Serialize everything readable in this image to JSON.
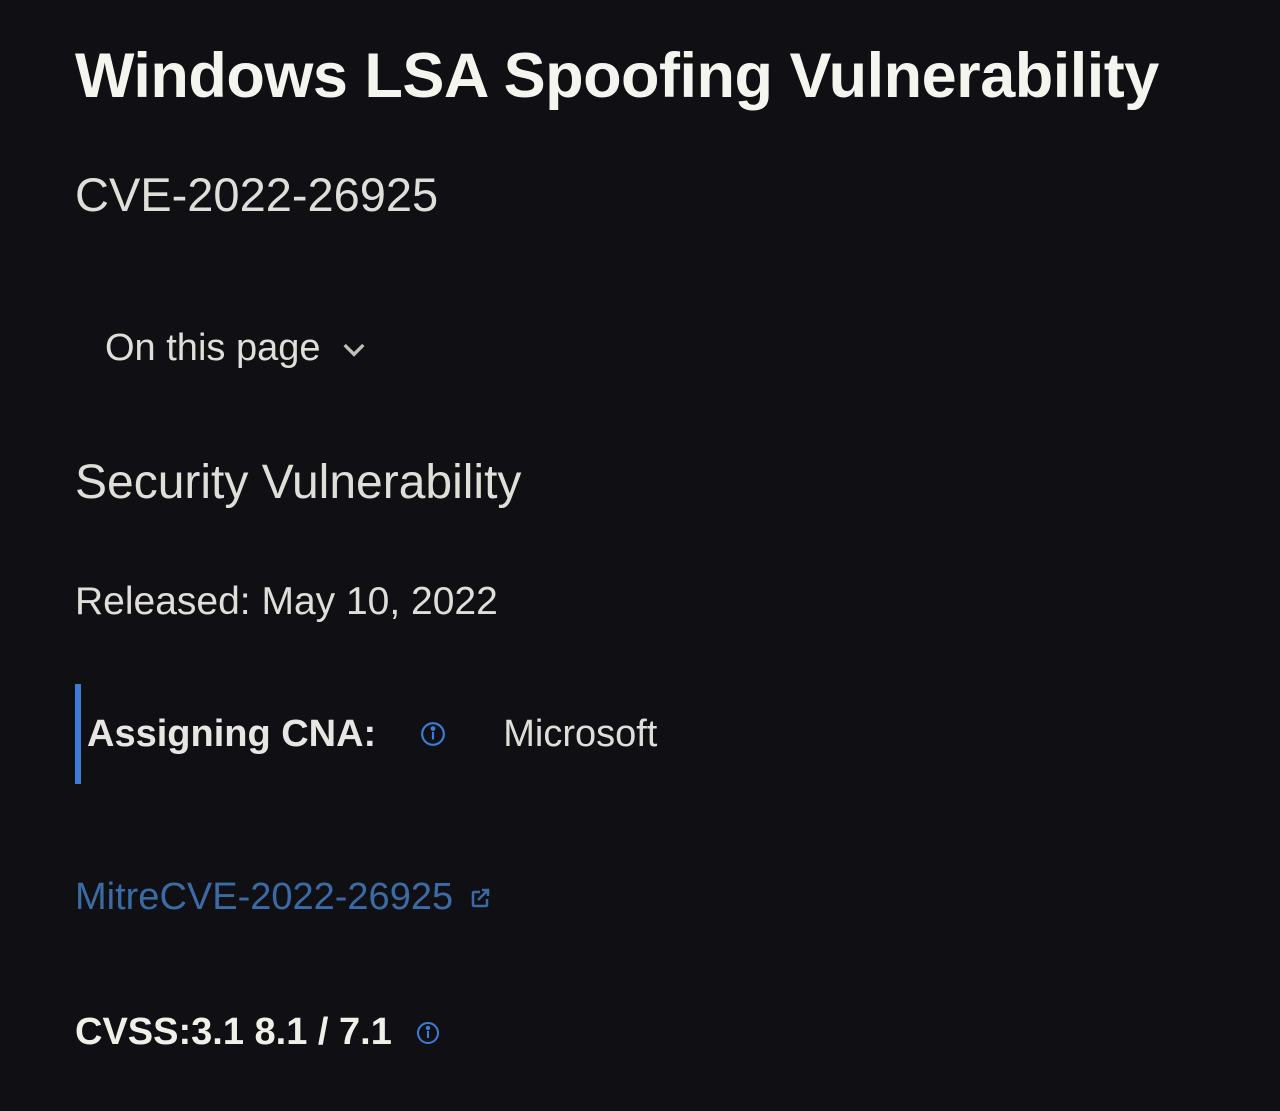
{
  "title": "Windows LSA Spoofing Vulnerability",
  "cve_id": "CVE-2022-26925",
  "on_this_page_label": "On this page",
  "section_heading": "Security Vulnerability",
  "released_label": "Released:",
  "released_date": "May 10, 2022",
  "cna": {
    "label": "Assigning CNA:",
    "value": "Microsoft"
  },
  "mitre_link": "MitreCVE-2022-26925",
  "cvss_text": "CVSS:3.1 8.1 / 7.1",
  "colors": {
    "link": "#3b6ba5",
    "accent_bar": "#3b7dd8"
  }
}
